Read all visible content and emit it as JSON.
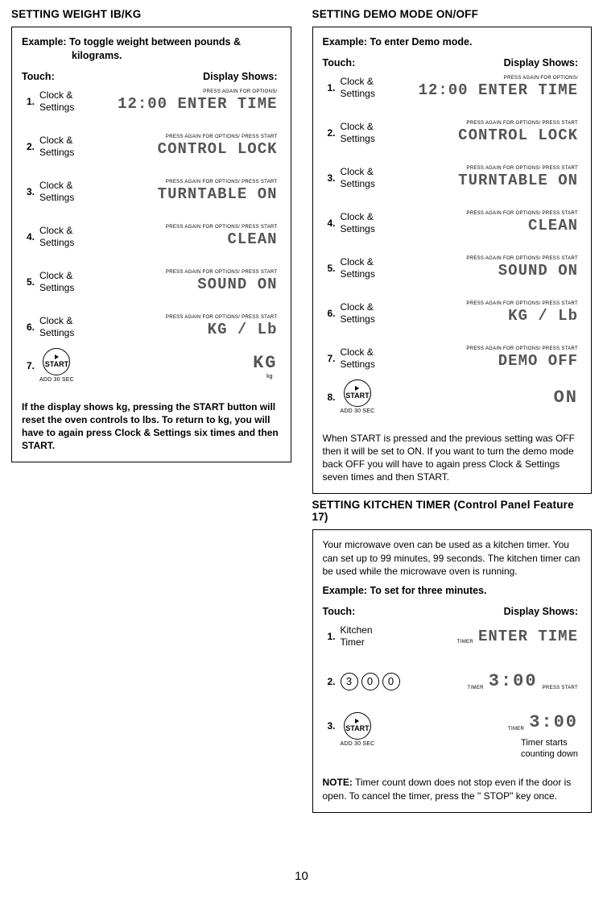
{
  "page_number": "10",
  "left": {
    "title": "SETTING WEIGHT IB/KG",
    "example_lead": "Example: To toggle weight between pounds &",
    "example_tail": "kilograms.",
    "touch_header": "Touch:",
    "display_header": "Display Shows:",
    "clock_settings_label": "Clock &",
    "clock_settings_label2": "Settings",
    "steps": [
      {
        "num": "1.",
        "tiny": "PRESS AGAIN FOR OPTIONS/",
        "lcd": "12:00 ENTER TIME"
      },
      {
        "num": "2.",
        "tiny": "PRESS AGAIN FOR OPTIONS/ PRESS START",
        "lcd": "CONTROL LOCK"
      },
      {
        "num": "3.",
        "tiny": "PRESS AGAIN FOR OPTIONS/  PRESS START",
        "lcd": "TURNTABLE ON"
      },
      {
        "num": "4.",
        "tiny": "PRESS AGAIN FOR OPTIONS/  PRESS START",
        "lcd": "CLEAN"
      },
      {
        "num": "5.",
        "tiny": "PRESS AGAIN FOR OPTIONS/  PRESS START",
        "lcd": "SOUND ON"
      },
      {
        "num": "6.",
        "tiny": "PRESS AGAIN FOR OPTIONS/  PRESS START",
        "lcd": "KG / Lb"
      }
    ],
    "step7_num": "7.",
    "step7_lcd": "KG",
    "step7_sub": "kg",
    "start_label": "START",
    "start_sub": "ADD 30 SEC",
    "footnote": "If the display shows kg, pressing the START button will reset the oven controls to lbs. To return to kg, you will have to again press Clock & Settings six times and then START."
  },
  "right": {
    "title": "SETTING DEMO MODE ON/OFF",
    "example": "Example: To enter Demo mode.",
    "touch_header": "Touch:",
    "display_header": "Display Shows:",
    "clock_settings_label": "Clock &",
    "clock_settings_label2": "Settings",
    "steps": [
      {
        "num": "1.",
        "tiny": "PRESS AGAIN FOR OPTIONS/",
        "lcd": "12:00 ENTER TIME"
      },
      {
        "num": "2.",
        "tiny": "PRESS AGAIN FOR OPTIONS/ PRESS START",
        "lcd": "CONTROL LOCK"
      },
      {
        "num": "3.",
        "tiny": "PRESS AGAIN FOR OPTIONS/  PRESS START",
        "lcd": "TURNTABLE ON"
      },
      {
        "num": "4.",
        "tiny": "PRESS AGAIN FOR OPTIONS/  PRESS START",
        "lcd": "CLEAN"
      },
      {
        "num": "5.",
        "tiny": "PRESS AGAIN FOR OPTIONS/  PRESS START",
        "lcd": "SOUND ON"
      },
      {
        "num": "6.",
        "tiny": "PRESS AGAIN FOR OPTIONS/  PRESS START",
        "lcd": "KG / Lb"
      },
      {
        "num": "7.",
        "tiny": "PRESS AGAIN FOR OPTIONS/  PRESS START",
        "lcd": "DEMO OFF"
      }
    ],
    "step8_num": "8.",
    "step8_lcd": "ON",
    "start_label": "START",
    "start_sub": "ADD 30 SEC",
    "footnote": "When START is pressed and the previous setting was OFF then it will be set to ON. If you want to turn the demo mode back OFF you will have to again press Clock & Settings seven times and then START."
  },
  "timer": {
    "title": "SETTING KITCHEN TIMER (Control Panel Feature 17)",
    "intro": "Your microwave oven can be used as a kitchen timer. You can set up to 99 minutes, 99 seconds. The kitchen timer can be used while the microwave oven is running.",
    "example": "Example: To set for three minutes.",
    "touch_header": "Touch:",
    "display_header": "Display Shows:",
    "step1_num": "1.",
    "step1_label_a": "Kitchen",
    "step1_label_b": "Timer",
    "step1_tiny": "TIMER",
    "step1_lcd": "ENTER TIME",
    "step2_num": "2.",
    "digits": [
      "3",
      "0",
      "0"
    ],
    "step2_tiny_l": "TIMER",
    "step2_tiny_r": "PRESS START",
    "step2_lcd": "3:00",
    "step3_num": "3.",
    "start_label": "START",
    "start_sub": "ADD 30 SEC",
    "step3_tiny": "TIMER",
    "step3_lcd": "3:00",
    "step3_sub_a": "Timer starts",
    "step3_sub_b": "counting down",
    "note_label": "NOTE:",
    "note_text": "Timer count down does not stop even if the door is open. To cancel the timer, press the \" STOP\" key once."
  }
}
